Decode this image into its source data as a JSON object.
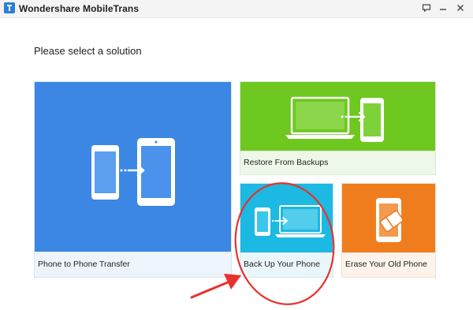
{
  "window": {
    "title": "Wondershare MobileTrans",
    "logo_icon": "mobiletrans-logo-icon",
    "controls": [
      "feedback-icon",
      "minimize-icon",
      "close-icon"
    ]
  },
  "main": {
    "heading": "Please select a solution",
    "tiles": [
      {
        "label": "Phone to Phone Transfer",
        "icon": "phone-to-phone-icon",
        "color": "#3b87e3"
      },
      {
        "label": "Restore From Backups",
        "icon": "laptop-to-phone-icon",
        "color": "#6ec81f"
      },
      {
        "label": "Back Up Your Phone",
        "icon": "phone-to-laptop-icon",
        "color": "#1cb9e2"
      },
      {
        "label": "Erase Your Old Phone",
        "icon": "phone-eraser-icon",
        "color": "#f07d1d"
      }
    ]
  },
  "annotation": {
    "highlight_color": "#e8312c",
    "marks": [
      "highlight-circle",
      "pointer-arrow"
    ]
  }
}
